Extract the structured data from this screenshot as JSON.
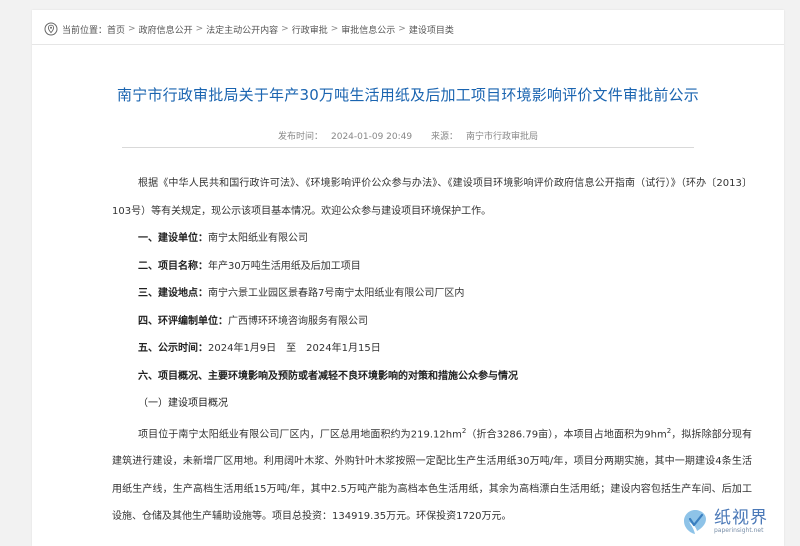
{
  "breadcrumb": {
    "label": "当前位置：",
    "items": [
      "首页",
      "政府信息公开",
      "法定主动公开内容",
      "行政审批",
      "审批信息公示",
      "建设项目类"
    ],
    "separator": ">"
  },
  "article": {
    "title": "南宁市行政审批局关于年产30万吨生活用纸及后加工项目环境影响评价文件审批前公示",
    "publish_time_label": "发布时间：",
    "publish_time": "2024-01-09 20:49",
    "source_label": "来源：",
    "source": "南宁市行政审批局",
    "intro": "根据《中华人民共和国行政许可法》、《环境影响评价公众参与办法》、《建设项目环境影响评价政府信息公开指南（试行）》（环办〔2013〕103号）等有关规定，现公示该项目基本情况。欢迎公众参与建设项目环境保护工作。",
    "items": [
      {
        "label": "一、建设单位：",
        "value": "南宁太阳纸业有限公司"
      },
      {
        "label": "二、项目名称：",
        "value": "年产30万吨生活用纸及后加工项目"
      },
      {
        "label": "三、建设地点：",
        "value": "南宁六景工业园区景春路7号南宁太阳纸业有限公司厂区内"
      },
      {
        "label": "四、环评编制单位：",
        "value": "广西博环环境咨询服务有限公司"
      },
      {
        "label": "五、公示时间：",
        "value": "2024年1月9日　至　2024年1月15日"
      }
    ],
    "section6_title": "六、项目概况、主要环境影响及预防或者减轻不良环境影响的对策和措施公众参与情况",
    "subsection1_title": "（一）建设项目概况",
    "overview": {
      "part1": "项目位于南宁太阳纸业有限公司厂区内，厂区总用地面积约为219.12hm",
      "sup1": "2",
      "part2": "（折合3286.79亩），本项目占地面积为9hm",
      "sup2": "2",
      "part3": "，拟拆除部分现有建筑进行建设，未新增厂区用地。利用阔叶木浆、外购针叶木浆按照一定配比生产生活用纸30万吨/年，项目分两期实施，其中一期建设4条生活用纸生产线，生产高档生活用纸15万吨/年，其中2.5万吨产能为高档本色生活用纸，其余为高档漂白生活用纸；建设内容包括生产车间、后加工设施、仓储及其他生产辅助设施等。项目总投资：134919.35万元。环保投资1720万元。"
    }
  },
  "watermark": {
    "name": "纸视界",
    "url": "paperinsight.net"
  },
  "colors": {
    "title_blue": "#1a64b0",
    "watermark_blue": "#4a78b7"
  }
}
